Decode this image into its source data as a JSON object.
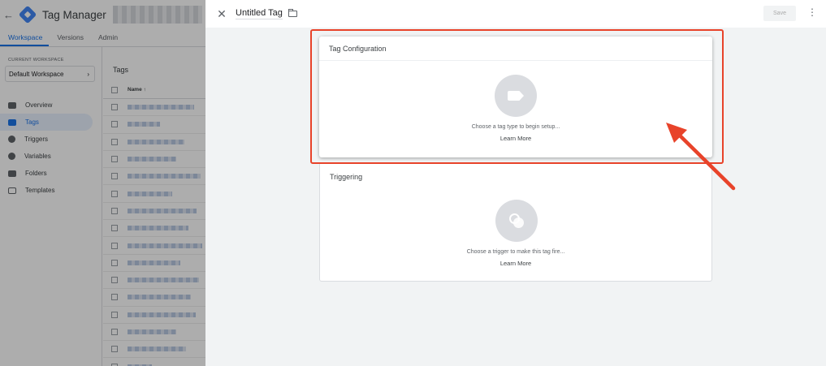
{
  "app": {
    "back": "←",
    "title": "Tag Manager"
  },
  "nav_tabs": [
    "Workspace",
    "Versions",
    "Admin"
  ],
  "sidebar": {
    "workspace_label": "CURRENT WORKSPACE",
    "workspace_name": "Default Workspace",
    "workspace_chevron": "›",
    "items": [
      {
        "label": "Overview",
        "icon": "overview-icon"
      },
      {
        "label": "Tags",
        "icon": "tag-icon"
      },
      {
        "label": "Triggers",
        "icon": "trigger-icon"
      },
      {
        "label": "Variables",
        "icon": "variable-icon"
      },
      {
        "label": "Folders",
        "icon": "folder-icon"
      },
      {
        "label": "Templates",
        "icon": "template-icon"
      }
    ]
  },
  "tags_list": {
    "title": "Tags",
    "column_name": "Name ↑"
  },
  "panel": {
    "close": "✕",
    "tag_name": "Untitled Tag",
    "save_label": "Save",
    "more": "⋮"
  },
  "tag_config": {
    "title": "Tag Configuration",
    "hint": "Choose a tag type to begin setup...",
    "learn_more": "Learn More"
  },
  "triggering": {
    "title": "Triggering",
    "hint": "Choose a trigger to make this tag fire...",
    "learn_more": "Learn More"
  },
  "colors": {
    "accent": "#1a73e8",
    "highlight": "#e8432a"
  }
}
